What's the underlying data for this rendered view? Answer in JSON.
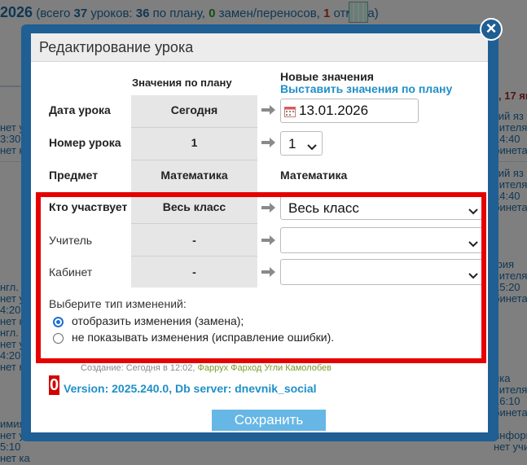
{
  "background": {
    "header": {
      "year": "2026",
      "part1": " (всего ",
      "total": "37",
      "part2": " уроков: ",
      "planned": "36",
      "part3": " по плану, ",
      "changes": "0",
      "part4": " замен/переносов, ",
      "cancels": "1",
      "part5": " отмена)"
    },
    "right_day": ", 17 ян",
    "right_col": [
      "кий яз",
      "чителя",
      "14:40",
      "бинета",
      "",
      "кий яз",
      "чителя",
      "14:40",
      "бинета",
      "",
      "",
      "",
      "",
      "фия",
      "чителя",
      "15:20",
      "бинета",
      "",
      "",
      "",
      "",
      "",
      "",
      "ика",
      "чителя",
      "16:10",
      "бинета",
      "",
      "информатик",
      "нет учителя"
    ],
    "left_col": [
      "нет уч",
      "3:30",
      "нет ка",
      "",
      "",
      "",
      "",
      "",
      "",
      "",
      "",
      "",
      "",
      "",
      "нгл.",
      "нет уч",
      "4:20",
      "нет ка",
      "нгл.",
      "нет уч",
      "4:20",
      "нет ка",
      "",
      "",
      "",
      "",
      "имия",
      "нет уч",
      "5:10",
      "нет ка"
    ]
  },
  "modal": {
    "title": "Редактирование урока",
    "close_glyph": "×",
    "plan_header": "Значения по плану",
    "new_header": "Новые значения",
    "set_plan_link": "Выставить значения по плану",
    "rows": {
      "date_label": "Дата урока",
      "date_plan": "Сегодня",
      "date_value": "13.01.2026",
      "number_label": "Номер урока",
      "number_plan": "1",
      "number_value": "1",
      "subject_label": "Предмет",
      "subject_plan": "Математика",
      "subject_value": "Математика",
      "who_label": "Кто участвует",
      "who_plan": "Весь класс",
      "who_value": "Весь класс",
      "teacher_label": "Учитель",
      "teacher_plan": "-",
      "teacher_value": "",
      "room_label": "Кабинет",
      "room_plan": "-",
      "room_value": ""
    },
    "change_type_label": "Выберите тип изменений:",
    "options": [
      {
        "label": "отобразить изменения (замена);",
        "selected": true
      },
      {
        "label": "не показывать изменения (исправление ошибки).",
        "selected": false
      }
    ],
    "created_label": "Создание: Сегодня в 12:02, ",
    "created_by": "Фаррух Фарход Угли Камолобев",
    "badge_count": "0",
    "version": "Version: 2025.240.0, Db server: dnevnik_social",
    "save_label": "Сохранить"
  },
  "colors": {
    "frame": "#1f5f93",
    "link": "#1f8fc8",
    "highlight": "#e60000",
    "save_button": "#67b7e6"
  },
  "icons": [
    "close-icon",
    "arrow-right-icon",
    "calendar-icon",
    "chevron-down-icon"
  ]
}
